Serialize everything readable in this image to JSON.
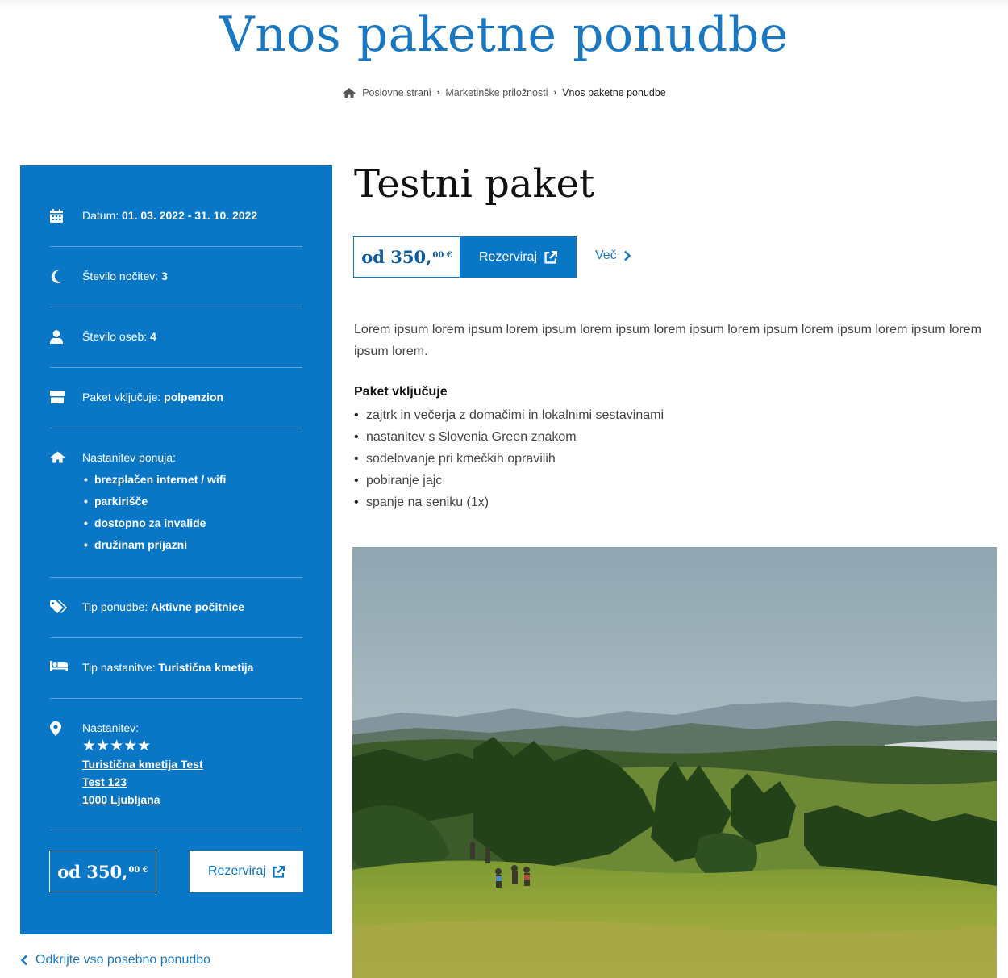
{
  "page": {
    "title": "Vnos paketne ponudbe"
  },
  "breadcrumb": {
    "items": [
      "Poslovne strani",
      "Marketinške priložnosti",
      "Vnos paketne ponudbe"
    ]
  },
  "sidebar": {
    "date": {
      "label": "Datum:",
      "value": "01. 03. 2022 - 31. 10. 2022",
      "icon": "calendar-icon"
    },
    "nights": {
      "label": "Število nočitev:",
      "value": "3",
      "icon": "moon-icon"
    },
    "persons": {
      "label": "Število oseb:",
      "value": "4",
      "icon": "user-icon"
    },
    "includes": {
      "label": "Paket vključuje:",
      "value": "polpenzion",
      "icon": "gift-icon"
    },
    "amenities": {
      "label": "Nastanitev ponuja:",
      "icon": "home-icon",
      "items": [
        "brezplačen internet / wifi",
        "parkirišče",
        "dostopno za invalide",
        "družinam prijazni"
      ]
    },
    "offer_type": {
      "label": "Tip ponudbe:",
      "value": "Aktivne počitnice",
      "icon": "tags-icon"
    },
    "accommodation_type": {
      "label": "Tip nastanitve:",
      "value": "Turistična kmetija",
      "icon": "bed-icon"
    },
    "accommodation": {
      "label": "Nastanitev:",
      "icon": "map-marker-icon",
      "stars": "★★★★★",
      "rating": 5,
      "name": "Turistična kmetija Test",
      "street": "Test 123",
      "city": "1000 Ljubljana"
    },
    "price": {
      "prefix": "od 350,",
      "cents": "00 €"
    },
    "book_label": "Rezerviraj"
  },
  "back_link": "Odkrijte vso posebno ponudbo",
  "main": {
    "title": "Testni paket",
    "price": {
      "prefix": "od 350,",
      "cents": "00 €"
    },
    "book_label": "Rezerviraj",
    "more_label": "Več",
    "description": "Lorem ipsum lorem ipsum lorem ipsum lorem ipsum lorem ipsum lorem ipsum lorem ipsum lorem ipsum lorem ipsum lorem.",
    "includes_title": "Paket vključuje",
    "includes": [
      "zajtrk in večerja z domačimi in lokalnimi sestavinami",
      "nastanitev s Slovenia Green znakom",
      "sodelovanje pri kmečkih opravilih",
      "pobiranje jajc",
      "spanje na seniku (1x)"
    ]
  },
  "colors": {
    "brand_blue": "#0a76c6",
    "title_blue": "#1a78c2"
  }
}
